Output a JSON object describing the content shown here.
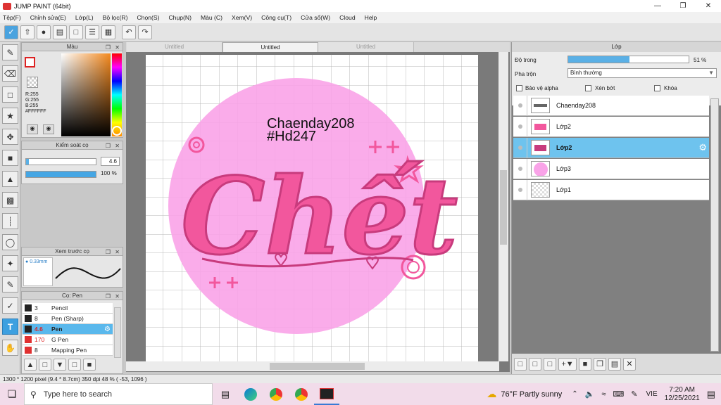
{
  "window": {
    "title": "JUMP PAINT (64bit)"
  },
  "menu": [
    "Tệp(F)",
    "Chỉnh sửa(E)",
    "Lớp(L)",
    "Bộ lọc(R)",
    "Chọn(S)",
    "Chụp(N)",
    "Màu (C)",
    "Xem(V)",
    "Công cụ(T)",
    "Cửa sổ(W)",
    "Cloud",
    "Help"
  ],
  "color_panel": {
    "title": "Màu",
    "r": "R:255",
    "g": "G:255",
    "b": "B:255",
    "hex": "#FFFFFF"
  },
  "brush_control": {
    "title": "Kiểm soát cọ",
    "size": "4.6",
    "opacity": "100 %"
  },
  "brush_preview": {
    "title": "Xem trước cọ",
    "size": "0.33mm"
  },
  "brush_list": {
    "title": "Cọ: Pen",
    "items": [
      {
        "size": "3",
        "name": "Pencil",
        "color": "#222222"
      },
      {
        "size": "8",
        "name": "Pen (Sharp)",
        "color": "#222222"
      },
      {
        "size": "4.6",
        "name": "Pen",
        "color": "#222222"
      },
      {
        "size": "170",
        "name": "G Pen",
        "color": "#e03030"
      },
      {
        "size": "8",
        "name": "Mapping Pen",
        "color": "#e03030"
      }
    ]
  },
  "tabs": [
    "Untitled",
    "Untitled",
    "Untitled"
  ],
  "artwork": {
    "text_line1": "Chaenday208",
    "text_line2": "#Hd247",
    "lettering": "Chết"
  },
  "layer_panel": {
    "title": "Lớp",
    "opacity_label": "Độ trong",
    "opacity_value": "51 %",
    "opacity_fraction": 0.51,
    "blend_label": "Pha trộn",
    "blend_value": "Bình thường",
    "protect_alpha": "Bảo vệ alpha",
    "clip": "Xén bớt",
    "lock": "Khóa",
    "layers": [
      {
        "name": "Chaenday208"
      },
      {
        "name": "Lớp2"
      },
      {
        "name": "Lớp2"
      },
      {
        "name": "Lớp3"
      },
      {
        "name": "Lớp1"
      }
    ]
  },
  "status": {
    "text": "1300 * 1200 pixel   (9.4 * 8.7cm)  350 dpi   48 %   ( -53, 1096 )"
  },
  "taskbar": {
    "search_placeholder": "Type here to search",
    "weather": "76°F  Partly sunny",
    "lang": "VIE",
    "time": "7:20 AM",
    "date": "12/25/2021"
  },
  "colors": {
    "accent": "#4aa3df",
    "selected_layer": "#6ec3ee",
    "circle_pink": "#f9a3e8",
    "letter_pink": "#f2579d"
  }
}
